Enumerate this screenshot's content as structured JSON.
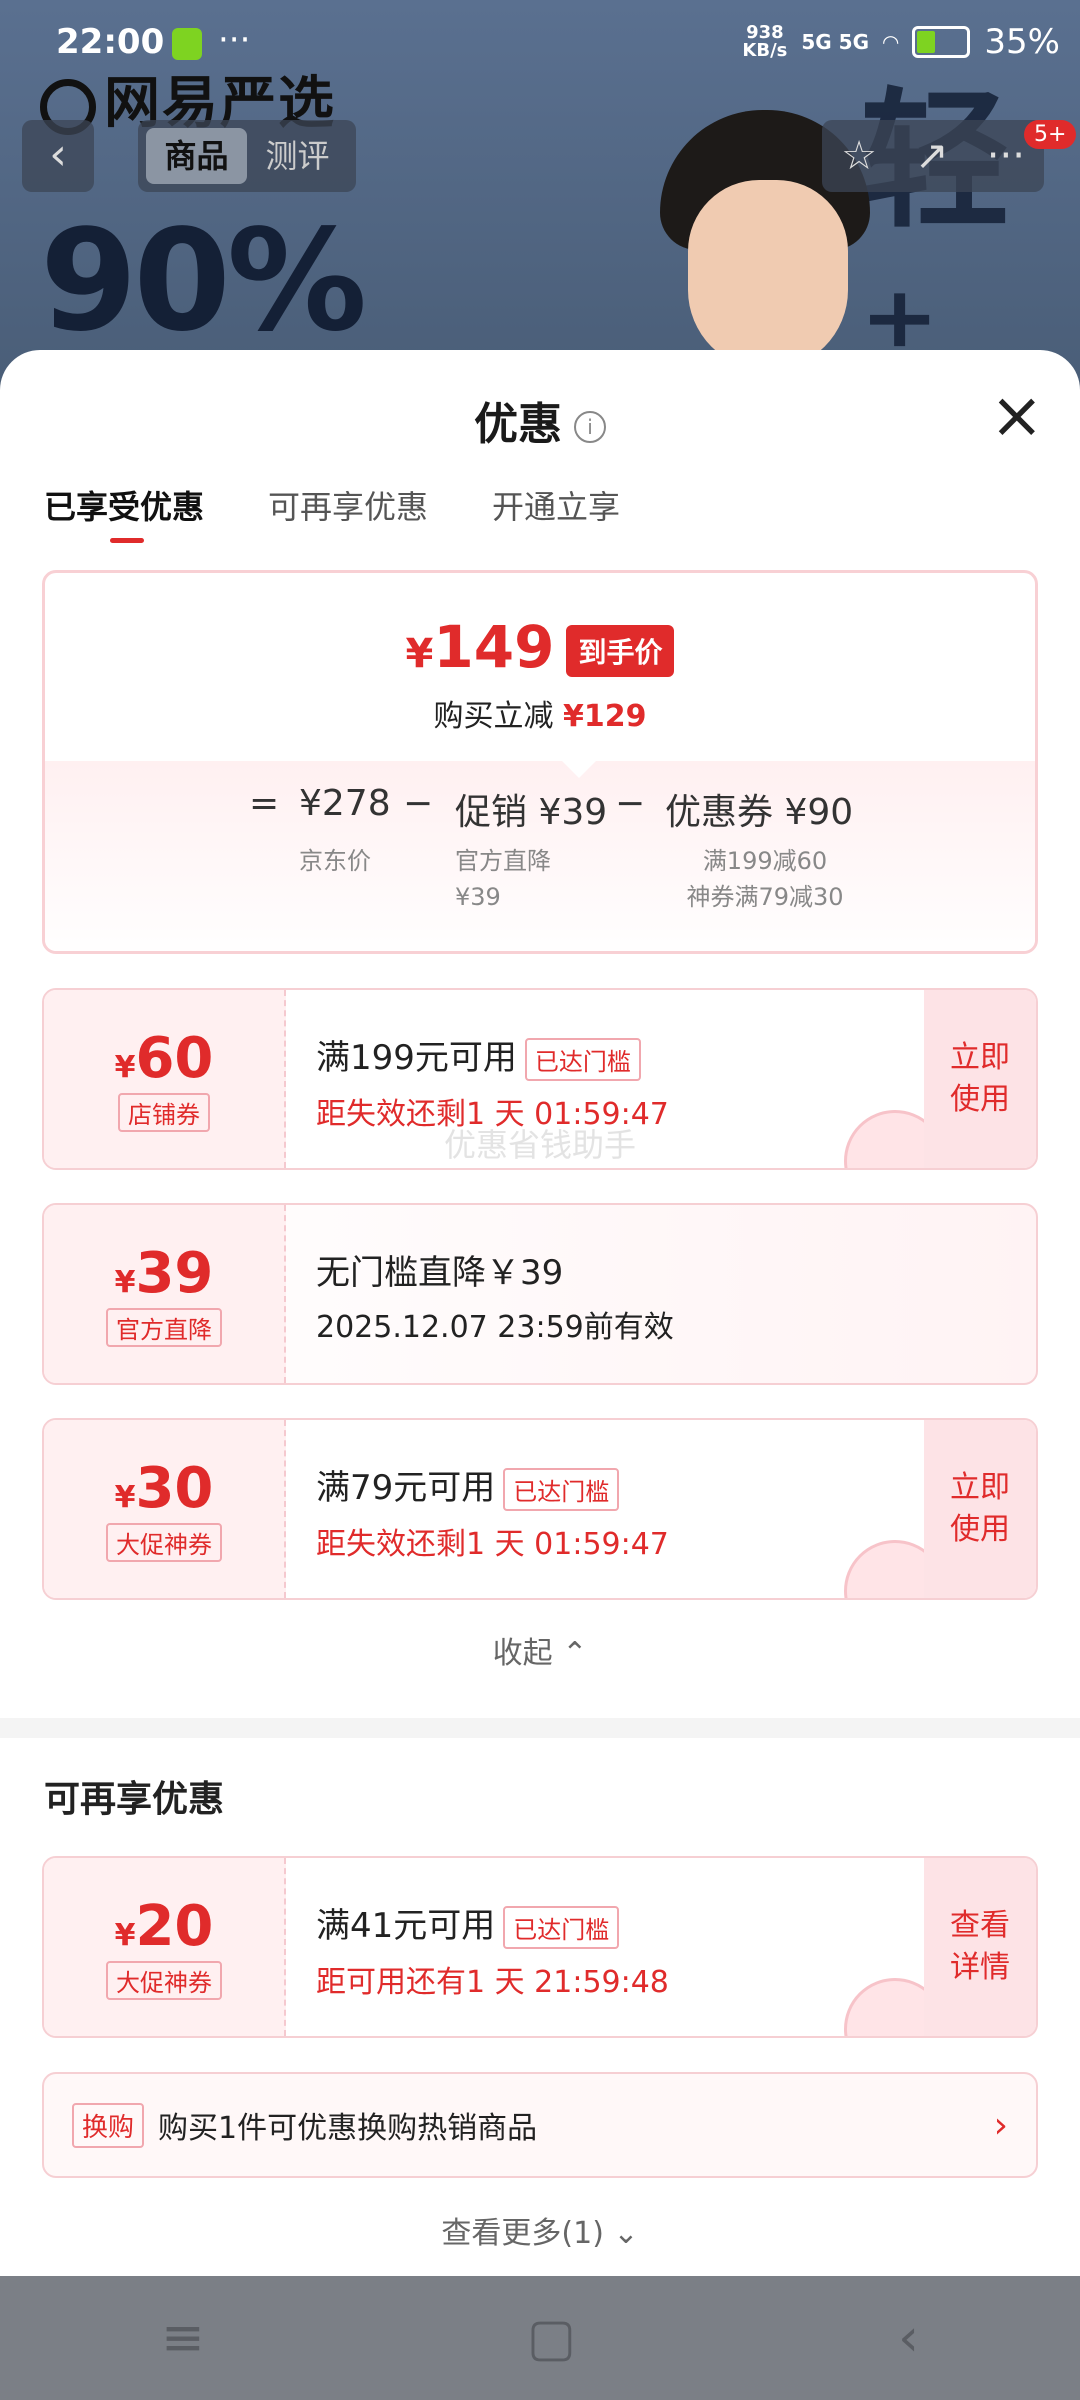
{
  "status_bar": {
    "time": "22:00",
    "dots": "···",
    "speed_top": "938",
    "speed_bottom": "KB/s",
    "signal": "5G 5G",
    "battery": "35%"
  },
  "header": {
    "brand": "网易严选",
    "back": "‹",
    "tabs": [
      "商品",
      "测评"
    ],
    "badge": "5+",
    "hero_text": "90%",
    "hero_light": "轻⁺"
  },
  "sheet": {
    "title": "优惠",
    "close": "×",
    "tabs": [
      "已享受优惠",
      "可再享优惠",
      "开通立享"
    ],
    "summary": {
      "price": "149",
      "price_symbol": "¥",
      "price_tag": "到手价",
      "minus_label": "购买立减",
      "minus_value": "¥129",
      "equation": {
        "eq": "=",
        "jd_price": "¥278",
        "minus1": "−",
        "promo": "促销 ¥39",
        "minus2": "−",
        "coupon": "优惠券 ¥90"
      },
      "jd_label": "京东价",
      "promo_sub1": "官方直降",
      "promo_sub2": "¥39",
      "coupon_sub1": "满199减60",
      "coupon_sub2": "神券满79减30"
    },
    "coupons": [
      {
        "amount": "60",
        "type": "店铺券",
        "line1": "满199元可用",
        "threshold": "已达门槛",
        "line2": "距失效还剩1 天 01:59:47",
        "action_line1": "立即",
        "action_line2": "使用"
      },
      {
        "amount": "39",
        "type": "官方直降",
        "line1": "无门槛直降￥39",
        "threshold": "",
        "line2": "2025.12.07 23:59前有效",
        "action_line1": "",
        "action_line2": ""
      },
      {
        "amount": "30",
        "type": "大促神券",
        "line1": "满79元可用",
        "threshold": "已达门槛",
        "line2": "距失效还剩1 天 01:59:47",
        "action_line1": "立即",
        "action_line2": "使用"
      }
    ],
    "watermark": "优惠省钱助手",
    "collapse": "收起 ⌃",
    "section_title": "可再享优惠",
    "extra_coupon": {
      "amount": "20",
      "type": "大促神券",
      "line1": "满41元可用",
      "threshold": "已达门槛",
      "line2": "距可用还有1 天 21:59:48",
      "action_line1": "查看",
      "action_line2": "详情"
    },
    "swap": {
      "tag": "换购",
      "text": "购买1件可优惠换购热销商品",
      "arrow": "›"
    },
    "more": "查看更多(1) ⌄"
  },
  "nav_bar": {
    "menu": "≡",
    "home": "▢",
    "back": "‹"
  },
  "colors": {
    "accent": "#e02b2b",
    "tag_border": "#f1a7ae"
  }
}
